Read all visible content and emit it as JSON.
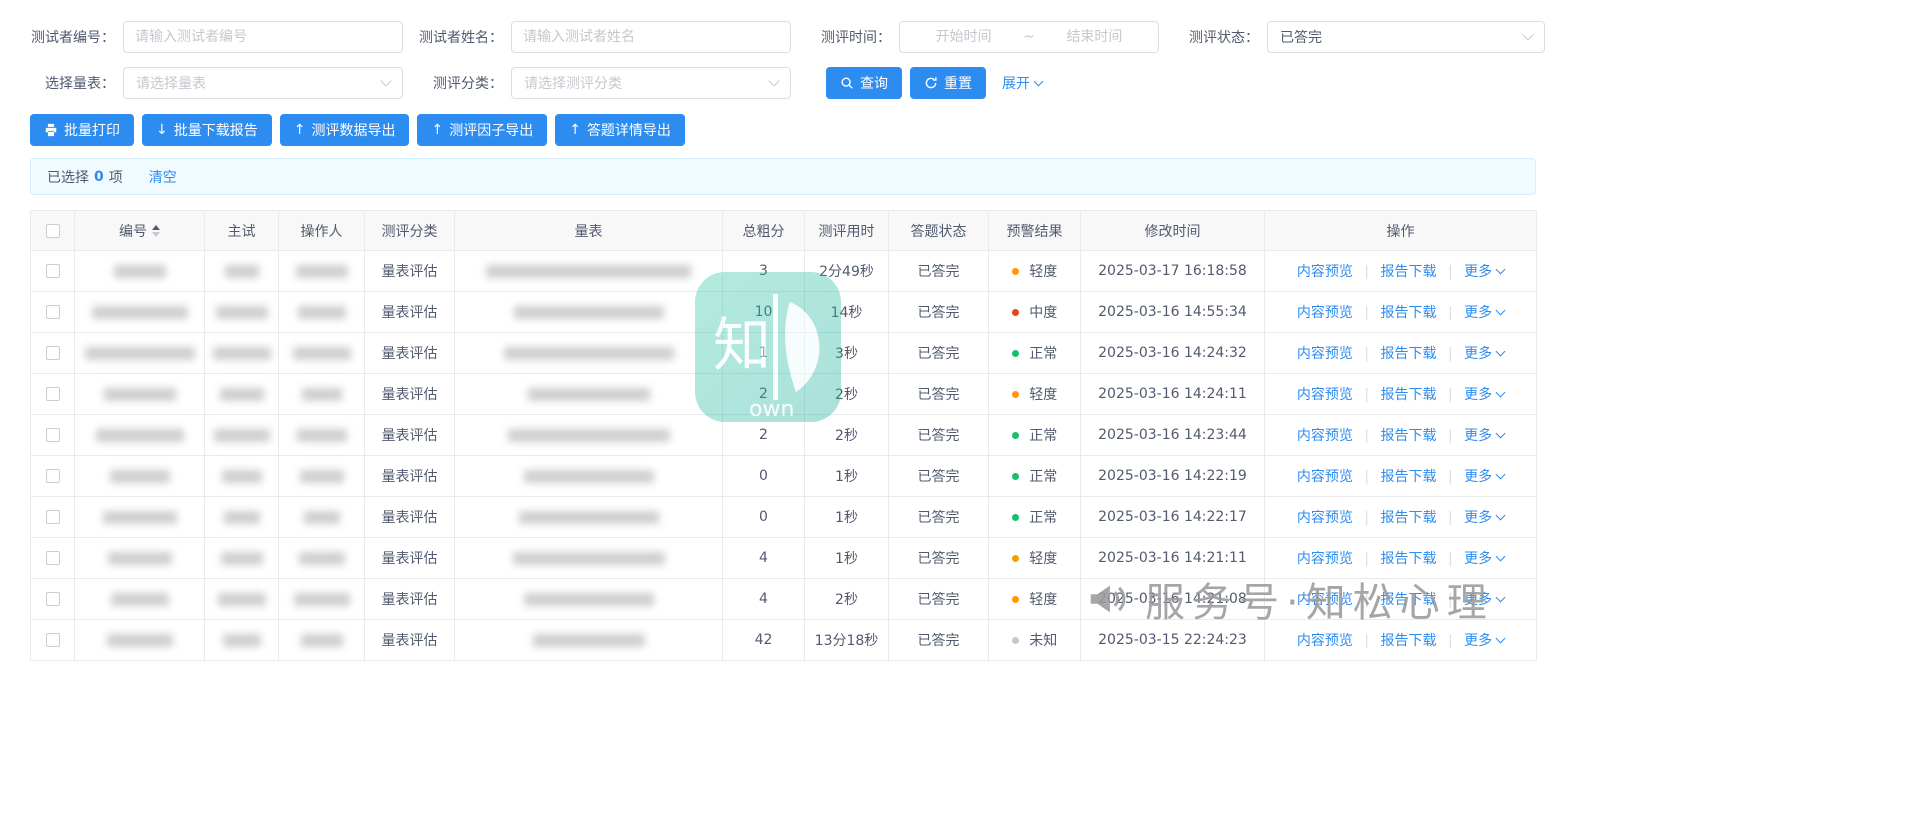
{
  "filters": {
    "tester_id": {
      "label": "测试者编号：",
      "placeholder": "请输入测试者编号"
    },
    "tester_name": {
      "label": "测试者姓名：",
      "placeholder": "请输入测试者姓名"
    },
    "assess_time": {
      "label": "测评时间：",
      "start_placeholder": "开始时间",
      "separator": "~",
      "end_placeholder": "结束时间"
    },
    "assess_status": {
      "label": "测评状态：",
      "value": "已答完"
    },
    "scale_select": {
      "label": "选择量表：",
      "placeholder": "请选择量表"
    },
    "category_select": {
      "label": "测评分类：",
      "placeholder": "请选择测评分类"
    },
    "search_button": "查询",
    "reset_button": "重置",
    "expand_link": "展开"
  },
  "toolbar": {
    "batch_print": "批量打印",
    "batch_download": "批量下载报告",
    "export_data": "测评数据导出",
    "export_factors": "测评因子导出",
    "export_answers": "答题详情导出"
  },
  "selection_bar": {
    "prefix": "已选择",
    "count": "0",
    "suffix": "项",
    "clear": "清空"
  },
  "table": {
    "headers": [
      "编号",
      "主试",
      "操作人",
      "测评分类",
      "量表",
      "总粗分",
      "测评用时",
      "答题状态",
      "预警结果",
      "修改时间",
      "操作"
    ],
    "row_actions": {
      "preview": "内容预览",
      "download": "报告下载",
      "more": "更多"
    },
    "rows": [
      {
        "category": "量表评估",
        "score": "3",
        "duration": "2分49秒",
        "status": "已答完",
        "warning": "轻度",
        "warning_color": "#ff9900",
        "modified": "2025-03-17 16:18:58"
      },
      {
        "category": "量表评估",
        "score": "10",
        "duration": "14秒",
        "status": "已答完",
        "warning": "中度",
        "warning_color": "#ed4014",
        "modified": "2025-03-16 14:55:34"
      },
      {
        "category": "量表评估",
        "score": "1",
        "duration": "3秒",
        "status": "已答完",
        "warning": "正常",
        "warning_color": "#19be6b",
        "modified": "2025-03-16 14:24:32"
      },
      {
        "category": "量表评估",
        "score": "2",
        "duration": "2秒",
        "status": "已答完",
        "warning": "轻度",
        "warning_color": "#ff9900",
        "modified": "2025-03-16 14:24:11"
      },
      {
        "category": "量表评估",
        "score": "2",
        "duration": "2秒",
        "status": "已答完",
        "warning": "正常",
        "warning_color": "#19be6b",
        "modified": "2025-03-16 14:23:44"
      },
      {
        "category": "量表评估",
        "score": "0",
        "duration": "1秒",
        "status": "已答完",
        "warning": "正常",
        "warning_color": "#19be6b",
        "modified": "2025-03-16 14:22:19"
      },
      {
        "category": "量表评估",
        "score": "0",
        "duration": "1秒",
        "status": "已答完",
        "warning": "正常",
        "warning_color": "#19be6b",
        "modified": "2025-03-16 14:22:17"
      },
      {
        "category": "量表评估",
        "score": "4",
        "duration": "1秒",
        "status": "已答完",
        "warning": "轻度",
        "warning_color": "#ff9900",
        "modified": "2025-03-16 14:21:11"
      },
      {
        "category": "量表评估",
        "score": "4",
        "duration": "2秒",
        "status": "已答完",
        "warning": "轻度",
        "warning_color": "#ff9900",
        "modified": "2025-03-16 14:21:08"
      },
      {
        "category": "量表评估",
        "score": "42",
        "duration": "13分18秒",
        "status": "已答完",
        "warning": "未知",
        "warning_color": "#c5c8ce",
        "modified": "2025-03-15 22:24:23"
      }
    ]
  },
  "watermark": {
    "logo_text": "own",
    "service_text": "服务号·知松心理"
  },
  "colors": {
    "primary": "#2d8cf0",
    "mild": "#ff9900",
    "moderate": "#ed4014",
    "normal": "#19be6b",
    "unknown": "#c5c8ce"
  }
}
